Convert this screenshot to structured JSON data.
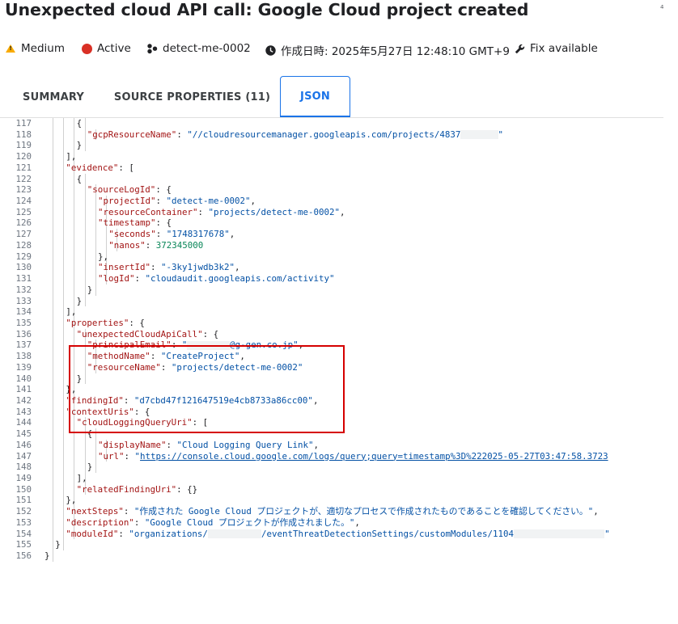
{
  "header": {
    "title": "Unexpected cloud API call: Google Cloud project created",
    "corner_mark": "⁴"
  },
  "meta": {
    "severity": "Medium",
    "state": "Active",
    "module": "detect-me-0002",
    "created": "作成日時: 2025年5月27日 12:48:10 GMT+9",
    "fix": "Fix available"
  },
  "tabs": [
    {
      "label": "SUMMARY"
    },
    {
      "label": "SOURCE PROPERTIES (11)"
    },
    {
      "label": "JSON"
    }
  ],
  "code_lines": [
    {
      "n": "117",
      "i": 5,
      "t": [
        [
          "p",
          "{"
        ]
      ]
    },
    {
      "n": "118",
      "i": 6,
      "t": [
        [
          "k",
          "\"gcpResourceName\""
        ],
        [
          "p",
          ": "
        ],
        [
          "s",
          "\"//cloudresourcemanager.googleapis.com/projects/4837"
        ],
        [
          "r",
          "7"
        ],
        [
          "s",
          "\""
        ]
      ]
    },
    {
      "n": "119",
      "i": 5,
      "t": [
        [
          "p",
          "}"
        ]
      ]
    },
    {
      "n": "120",
      "i": 4,
      "t": [
        [
          "p",
          "],"
        ]
      ]
    },
    {
      "n": "121",
      "i": 4,
      "t": [
        [
          "k",
          "\"evidence\""
        ],
        [
          "p",
          ": ["
        ]
      ]
    },
    {
      "n": "122",
      "i": 5,
      "t": [
        [
          "p",
          "{"
        ]
      ]
    },
    {
      "n": "123",
      "i": 6,
      "t": [
        [
          "k",
          "\"sourceLogId\""
        ],
        [
          "p",
          ": {"
        ]
      ]
    },
    {
      "n": "124",
      "i": 7,
      "t": [
        [
          "k",
          "\"projectId\""
        ],
        [
          "p",
          ": "
        ],
        [
          "s",
          "\"detect-me-0002\""
        ],
        [
          "p",
          ","
        ]
      ]
    },
    {
      "n": "125",
      "i": 7,
      "t": [
        [
          "k",
          "\"resourceContainer\""
        ],
        [
          "p",
          ": "
        ],
        [
          "s",
          "\"projects/detect-me-0002\""
        ],
        [
          "p",
          ","
        ]
      ]
    },
    {
      "n": "126",
      "i": 7,
      "t": [
        [
          "k",
          "\"timestamp\""
        ],
        [
          "p",
          ": {"
        ]
      ]
    },
    {
      "n": "127",
      "i": 8,
      "t": [
        [
          "k",
          "\"seconds\""
        ],
        [
          "p",
          ": "
        ],
        [
          "s",
          "\"1748317678\""
        ],
        [
          "p",
          ","
        ]
      ]
    },
    {
      "n": "128",
      "i": 8,
      "t": [
        [
          "k",
          "\"nanos\""
        ],
        [
          "p",
          ": "
        ],
        [
          "n",
          "372345000"
        ]
      ]
    },
    {
      "n": "129",
      "i": 7,
      "t": [
        [
          "p",
          "},"
        ]
      ]
    },
    {
      "n": "130",
      "i": 7,
      "t": [
        [
          "k",
          "\"insertId\""
        ],
        [
          "p",
          ": "
        ],
        [
          "s",
          "\"-3ky1jwdb3k2\""
        ],
        [
          "p",
          ","
        ]
      ]
    },
    {
      "n": "131",
      "i": 7,
      "t": [
        [
          "k",
          "\"logId\""
        ],
        [
          "p",
          ": "
        ],
        [
          "s",
          "\"cloudaudit.googleapis.com/activity\""
        ]
      ]
    },
    {
      "n": "132",
      "i": 6,
      "t": [
        [
          "p",
          "}"
        ]
      ]
    },
    {
      "n": "133",
      "i": 5,
      "t": [
        [
          "p",
          "}"
        ]
      ]
    },
    {
      "n": "134",
      "i": 4,
      "t": [
        [
          "p",
          "],"
        ]
      ]
    },
    {
      "n": "135",
      "i": 4,
      "t": [
        [
          "k",
          "\"properties\""
        ],
        [
          "p",
          ": {"
        ]
      ]
    },
    {
      "n": "136",
      "i": 5,
      "t": [
        [
          "k",
          "\"unexpectedCloudApiCall\""
        ],
        [
          "p",
          ": {"
        ]
      ]
    },
    {
      "n": "137",
      "i": 6,
      "t": [
        [
          "k",
          "\"principalEmail\""
        ],
        [
          "p",
          ": "
        ],
        [
          "s",
          "\""
        ],
        [
          "r",
          "8"
        ],
        [
          "s",
          "@g-gen.co.jp\""
        ],
        [
          "p",
          ","
        ]
      ]
    },
    {
      "n": "138",
      "i": 6,
      "t": [
        [
          "k",
          "\"methodName\""
        ],
        [
          "p",
          ": "
        ],
        [
          "s",
          "\"CreateProject\""
        ],
        [
          "p",
          ","
        ]
      ]
    },
    {
      "n": "139",
      "i": 6,
      "t": [
        [
          "k",
          "\"resourceName\""
        ],
        [
          "p",
          ": "
        ],
        [
          "s",
          "\"projects/detect-me-0002\""
        ]
      ]
    },
    {
      "n": "140",
      "i": 5,
      "t": [
        [
          "p",
          "}"
        ]
      ]
    },
    {
      "n": "141",
      "i": 4,
      "t": [
        [
          "p",
          "},"
        ]
      ]
    },
    {
      "n": "142",
      "i": 4,
      "t": [
        [
          "k",
          "\"findingId\""
        ],
        [
          "p",
          ": "
        ],
        [
          "s",
          "\"d7cbd47f121647519e4cb8733a86cc00\""
        ],
        [
          "p",
          ","
        ]
      ]
    },
    {
      "n": "143",
      "i": 4,
      "t": [
        [
          "k",
          "\"contextUris\""
        ],
        [
          "p",
          ": {"
        ]
      ]
    },
    {
      "n": "144",
      "i": 5,
      "t": [
        [
          "k",
          "\"cloudLoggingQueryUri\""
        ],
        [
          "p",
          ": ["
        ]
      ]
    },
    {
      "n": "145",
      "i": 6,
      "t": [
        [
          "p",
          "{"
        ]
      ]
    },
    {
      "n": "146",
      "i": 7,
      "t": [
        [
          "k",
          "\"displayName\""
        ],
        [
          "p",
          ": "
        ],
        [
          "s",
          "\"Cloud Logging Query Link\""
        ],
        [
          "p",
          ","
        ]
      ]
    },
    {
      "n": "147",
      "i": 7,
      "t": [
        [
          "k",
          "\"url\""
        ],
        [
          "p",
          ": "
        ],
        [
          "s",
          "\""
        ],
        [
          "u",
          "https://console.cloud.google.com/logs/query;query=timestamp%3D%222025-05-27T03:47:58.3723"
        ]
      ]
    },
    {
      "n": "148",
      "i": 6,
      "t": [
        [
          "p",
          "}"
        ]
      ]
    },
    {
      "n": "149",
      "i": 5,
      "t": [
        [
          "p",
          "],"
        ]
      ]
    },
    {
      "n": "150",
      "i": 5,
      "t": [
        [
          "k",
          "\"relatedFindingUri\""
        ],
        [
          "p",
          ": {}"
        ]
      ]
    },
    {
      "n": "151",
      "i": 4,
      "t": [
        [
          "p",
          "},"
        ]
      ]
    },
    {
      "n": "152",
      "i": 4,
      "t": [
        [
          "k",
          "\"nextSteps\""
        ],
        [
          "p",
          ": "
        ],
        [
          "s",
          "\"作成された Google Cloud プロジェクトが、適切なプロセスで作成されたものであることを確認してください。\""
        ],
        [
          "p",
          ","
        ]
      ]
    },
    {
      "n": "153",
      "i": 4,
      "t": [
        [
          "k",
          "\"description\""
        ],
        [
          "p",
          ": "
        ],
        [
          "s",
          "\"Google Cloud プロジェクトが作成されました。\""
        ],
        [
          "p",
          ","
        ]
      ]
    },
    {
      "n": "154",
      "i": 4,
      "t": [
        [
          "k",
          "\"moduleId\""
        ],
        [
          "p",
          ": "
        ],
        [
          "s",
          "\"organizations/"
        ],
        [
          "r",
          "10"
        ],
        [
          "s",
          "/eventThreatDetectionSettings/customModules/1104"
        ],
        [
          "r",
          "17"
        ],
        [
          "s",
          "\""
        ]
      ]
    },
    {
      "n": "155",
      "i": 3,
      "t": [
        [
          "p",
          "}"
        ]
      ]
    },
    {
      "n": "156",
      "i": 2,
      "t": [
        [
          "p",
          "}"
        ]
      ]
    }
  ],
  "colors": {
    "accent": "#1a73e8",
    "json_key": "#a31515",
    "json_string": "#0451a5",
    "json_number": "#098658",
    "highlight_box": "#d50000",
    "severity_icon": "#f9ab00",
    "state_dot": "#d93025"
  },
  "icons": [
    "warning-icon",
    "active-dot-icon",
    "module-icon",
    "clock-icon",
    "wrench-icon"
  ]
}
